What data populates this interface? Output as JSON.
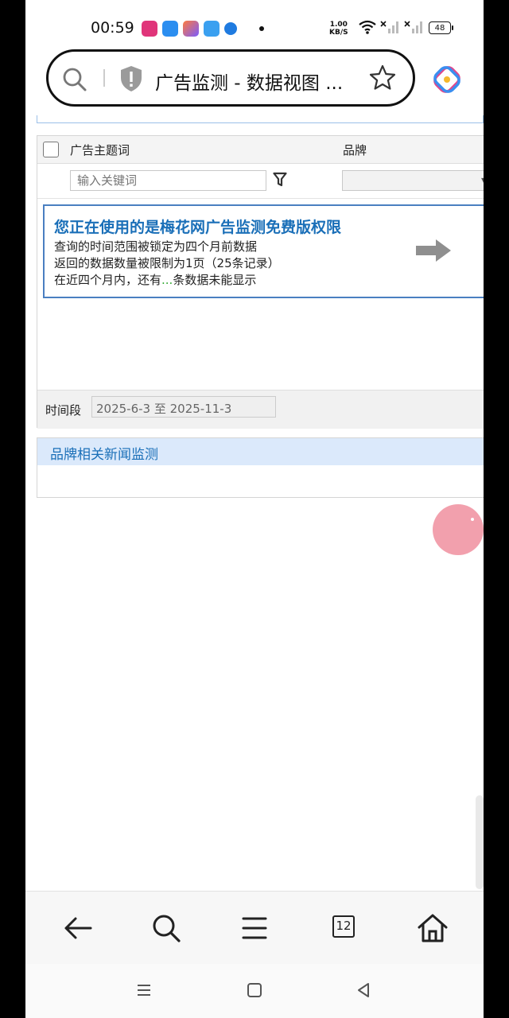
{
  "status_bar": {
    "time": "00:59",
    "speed_value": "1.00",
    "speed_unit": "KB/S",
    "battery": "48"
  },
  "address_bar": {
    "title": "广告监测 - 数据视图 ..."
  },
  "filter_table": {
    "col_topic": "广告主题词",
    "col_brand": "品牌",
    "keyword_placeholder": "输入关键词"
  },
  "promo": {
    "title": "您正在使用的是梅花网广告监测免费版权限",
    "line1": "查询的时间范围被锁定为四个月前数据",
    "line2": "返回的数据数量被限制为1页（25条记录）",
    "line3_prefix": "在近四个月内，还有",
    "line3_dots": "...",
    "line3_suffix": "条数据未能显示"
  },
  "time_range": {
    "label": "时间段",
    "value": "2025-6-3 至 2025-11-3"
  },
  "news": {
    "title": "品牌相关新闻监测"
  },
  "toolbar": {
    "tabs_count": "12"
  },
  "icons": [
    "search-icon",
    "shield-icon",
    "star-icon",
    "extension-icon",
    "filter-icon",
    "arrow-right-icon",
    "back-icon",
    "menu-icon",
    "tabs-icon",
    "home-icon"
  ],
  "colors": {
    "accent_blue": "#1a6fb8",
    "promo_border": "#4a7fc1",
    "news_header_bg": "#dbe9fb",
    "float_ball": "#f2a0ad"
  }
}
